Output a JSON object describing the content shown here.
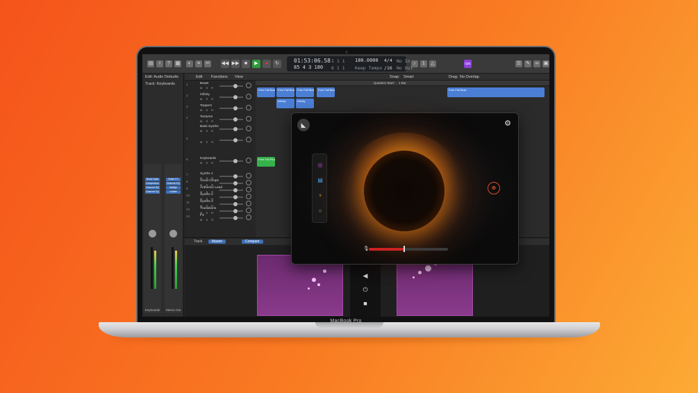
{
  "device": {
    "label": "MacBook Pro"
  },
  "toolbar": {
    "lcd": {
      "time": "01:53:06.58",
      "bars": "85  4  3  180",
      "pos_a": "1  1  1",
      "pos_b": "6  1  1",
      "tempo": "180.0000",
      "tempo_label": "Keep Tempo",
      "signature": "4/4",
      "division": "/16",
      "in_label": "No In",
      "out_label": "No Out"
    },
    "badge": "cpu"
  },
  "inspector": {
    "edit_label": "Edit: Audio Defaults",
    "track_label": "Track: Keyboards",
    "strips": [
      {
        "name": "Keyboards",
        "plugins": [
          "Noise Gate",
          "Compressor",
          "Channel EQ",
          "Channel EQ"
        ]
      },
      {
        "name": "Stereo Out",
        "plugins": [
          "Noise FX",
          "Channel EQ",
          "Multipr",
          "Limiter"
        ]
      }
    ]
  },
  "menubar": {
    "edit": "Edit",
    "functions": "Functions",
    "view": "View",
    "snap_label": "Snap:",
    "snap_value": "Smart",
    "drag_label": "Drag:",
    "drag_value": "No Overlap",
    "quantize_label": "Quantize Start:",
    "quantize_value": "1 Bar"
  },
  "tracks": [
    {
      "num": "1",
      "name": "Beats"
    },
    {
      "num": "2",
      "name": "Infinity"
    },
    {
      "num": "3",
      "name": "Toppers"
    },
    {
      "num": "4",
      "name": "Textures"
    },
    {
      "num": "",
      "name": "Bass Synths"
    },
    {
      "num": "5",
      "name": ""
    },
    {
      "num": "6",
      "name": "Keyboards"
    },
    {
      "num": "7",
      "name": "Synths 1"
    },
    {
      "num": "8",
      "name": "Vocal Chops"
    },
    {
      "num": "9",
      "name": "Anthemic Lead"
    },
    {
      "num": "10",
      "name": "Synths 2"
    },
    {
      "num": "11",
      "name": "Synths 3"
    },
    {
      "num": "12",
      "name": "Transitions"
    },
    {
      "num": "13",
      "name": "FX"
    }
  ],
  "regions": [
    {
      "label": "Free Fall Beat",
      "color": "#4b7fd6"
    },
    {
      "label": "Free Fall Beat",
      "color": "#4b7fd6"
    },
    {
      "label": "Free Fall Beat",
      "color": "#4b7fd6"
    },
    {
      "label": "Free Fall Beat",
      "color": "#4b7fd6"
    },
    {
      "label": "Infinity",
      "color": "#4b7fd6"
    },
    {
      "label": "Infinity",
      "color": "#4b7fd6"
    },
    {
      "label": "Free Fall Pluck",
      "color": "#35b24a"
    },
    {
      "label": "Free Fall Beat",
      "color": "#4b7fd6"
    }
  ],
  "bottom": {
    "track_tab": "Track",
    "master_tab": "Master",
    "compare_tab": "Compare",
    "pad_left_label": "",
    "pad_right_label": ""
  },
  "plugin": {
    "logo_icon": "plugin-logo-icon",
    "settings_icon": "gear-icon",
    "orb_color": "#f7a21b",
    "accent_color": "#e24a2a",
    "side_icons": [
      {
        "icon": "orbit-icon",
        "color": "#c04ad8"
      },
      {
        "icon": "sliders-icon",
        "color": "#4aa8e8"
      },
      {
        "icon": "lamp-icon",
        "color": "#e8b43a"
      },
      {
        "icon": "circle-icon",
        "color": "#5ad86a"
      }
    ],
    "input_level": 0.46
  }
}
